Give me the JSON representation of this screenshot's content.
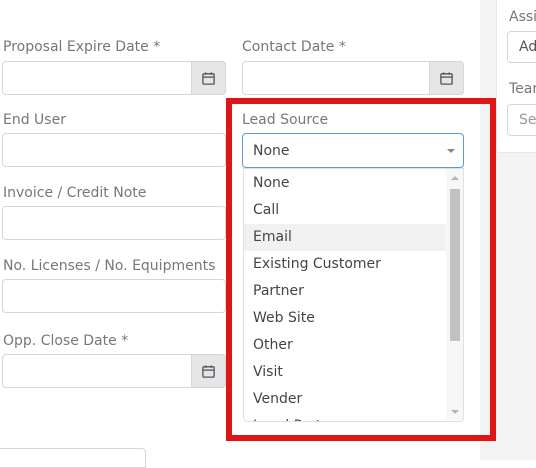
{
  "form": {
    "proposal_expire_label": "Proposal Expire Date *",
    "contact_date_label": "Contact Date *",
    "end_user_label": "End User",
    "lead_source_label": "Lead Source",
    "invoice_label": "Invoice / Credit Note",
    "licenses_label": "No. Licenses / No. Equipments",
    "close_date_label": "Opp. Close Date *"
  },
  "lead_source": {
    "selected": "None",
    "options": [
      "None",
      "Call",
      "Email",
      "Existing Customer",
      "Partner",
      "Web Site",
      "Other",
      "Visit",
      "Vender",
      "Local Partner"
    ],
    "hovered_index": 2
  },
  "right_panel": {
    "assign_label": "Assig",
    "assign_value": "Ad",
    "team_label": "Tear",
    "team_placeholder": "Se"
  },
  "colors": {
    "highlight": "#e01515",
    "focus_border": "#5b9bd5",
    "addon_bg": "#e4e6e8"
  },
  "icons": {
    "date_addon": "calendar-icon",
    "select_caret": "caret-down-icon"
  }
}
